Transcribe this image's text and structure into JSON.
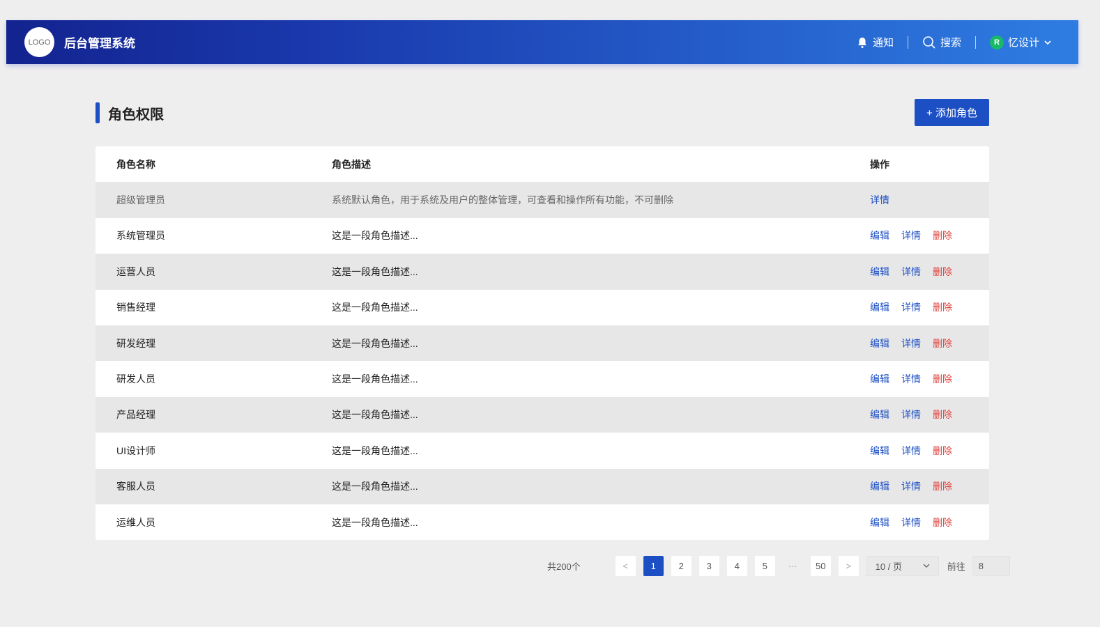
{
  "header": {
    "logo": "LOGO",
    "title": "后台管理系统",
    "notify": "通知",
    "search": "搜索",
    "avatar_letter": "R",
    "user": "忆设计"
  },
  "page": {
    "title": "角色权限",
    "add_button": "+ 添加角色"
  },
  "table": {
    "columns": [
      "角色名称",
      "角色描述",
      "操作"
    ],
    "actions": {
      "edit": "编辑",
      "detail": "详情",
      "delete": "删除"
    },
    "rows": [
      {
        "name": "超级管理员",
        "desc": "系统默认角色，用于系统及用户的整体管理，可查看和操作所有功能，不可删除"
      },
      {
        "name": "系统管理员",
        "desc": "这是一段角色描述..."
      },
      {
        "name": "运营人员",
        "desc": "这是一段角色描述..."
      },
      {
        "name": "销售经理",
        "desc": "这是一段角色描述..."
      },
      {
        "name": "研发经理",
        "desc": "这是一段角色描述..."
      },
      {
        "name": "研发人员",
        "desc": "这是一段角色描述..."
      },
      {
        "name": "产品经理",
        "desc": "这是一段角色描述..."
      },
      {
        "name": "UI设计师",
        "desc": "这是一段角色描述..."
      },
      {
        "name": "客服人员",
        "desc": "这是一段角色描述..."
      },
      {
        "name": "运维人员",
        "desc": "这是一段角色描述..."
      }
    ]
  },
  "pagination": {
    "total": "共200个",
    "prev": "<",
    "pages": [
      "1",
      "2",
      "3",
      "4",
      "5"
    ],
    "ellipsis": "···",
    "last": "50",
    "next": ">",
    "page_size": "10 / 页",
    "goto_label": "前往",
    "goto_value": "8",
    "current": 1
  }
}
